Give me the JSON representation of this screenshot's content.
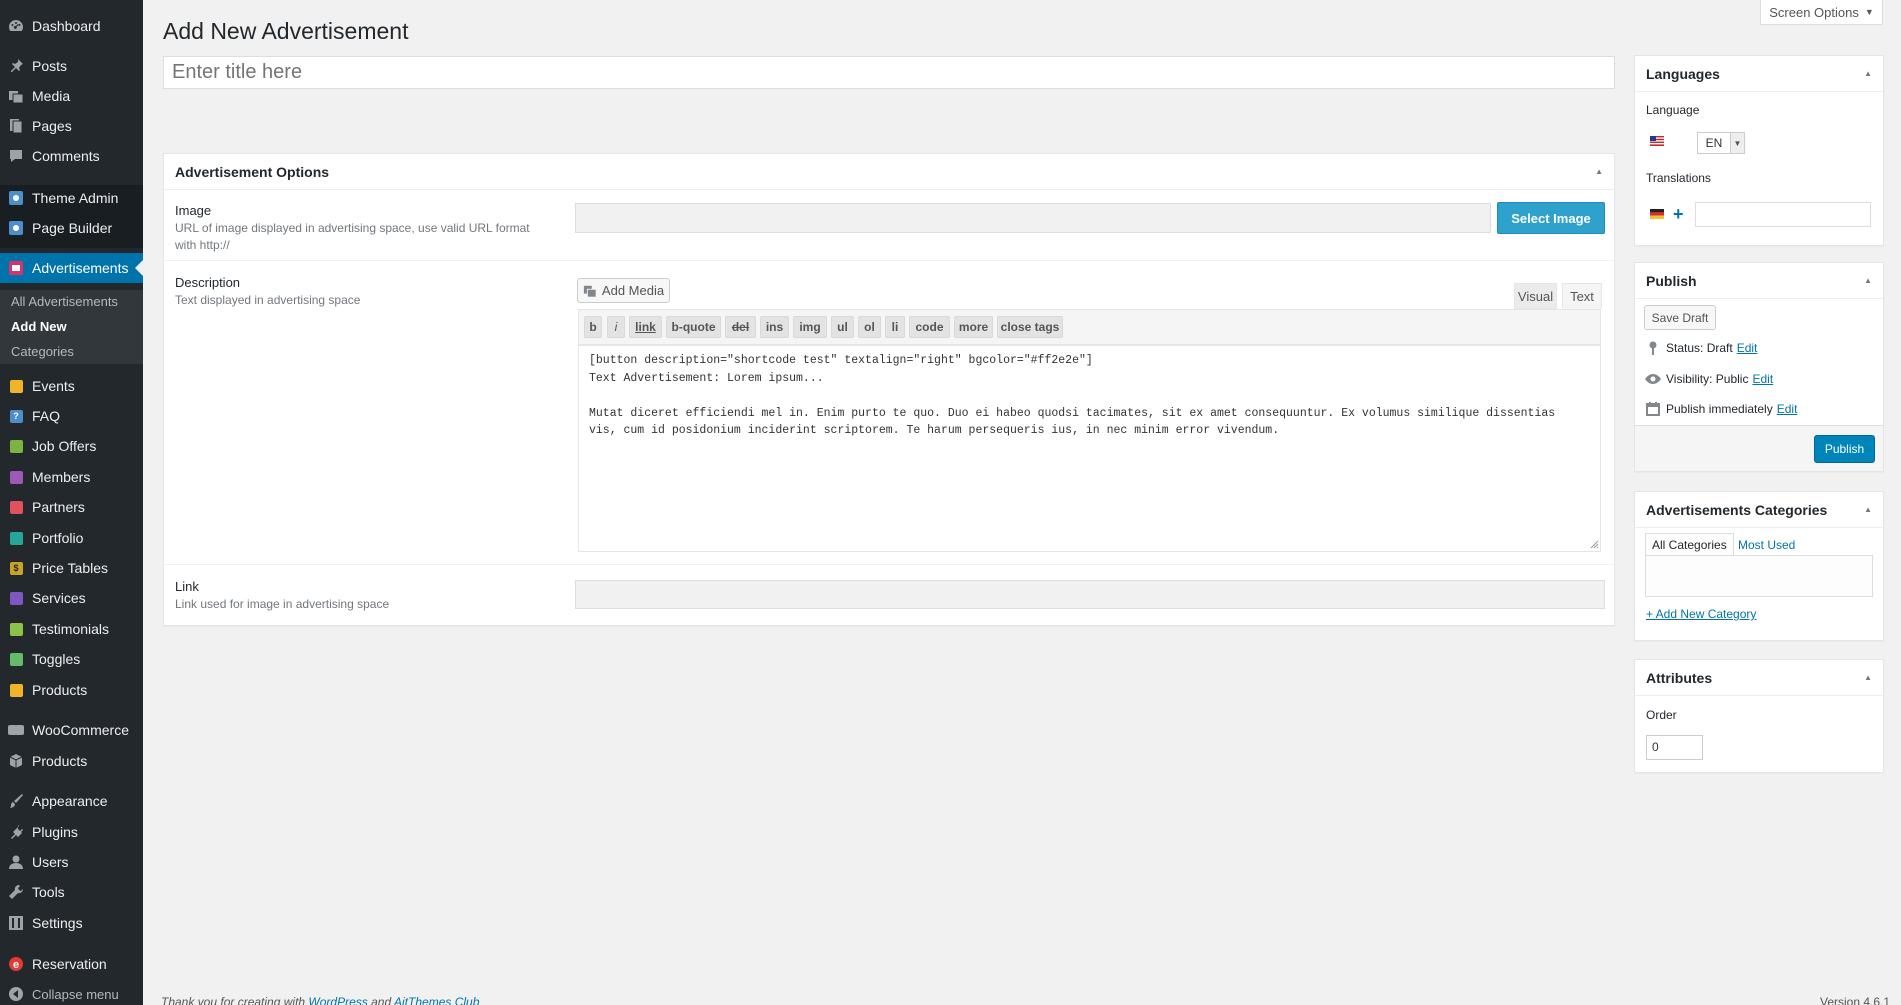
{
  "sidebar": {
    "items": [
      {
        "label": "Dashboard",
        "icon": "dashboard-icon"
      },
      {
        "label": "Posts",
        "icon": "pin-icon"
      },
      {
        "label": "Media",
        "icon": "media-icon"
      },
      {
        "label": "Pages",
        "icon": "pages-icon"
      },
      {
        "label": "Comments",
        "icon": "comment-icon"
      },
      {
        "label": "Theme Admin",
        "icon": "theme-admin-icon"
      },
      {
        "label": "Page Builder",
        "icon": "page-builder-icon"
      },
      {
        "label": "Advertisements",
        "icon": "advertisement-icon"
      },
      {
        "label": "Events",
        "icon": "events-icon"
      },
      {
        "label": "FAQ",
        "icon": "faq-icon"
      },
      {
        "label": "Job Offers",
        "icon": "job-offers-icon"
      },
      {
        "label": "Members",
        "icon": "members-icon"
      },
      {
        "label": "Partners",
        "icon": "partners-icon"
      },
      {
        "label": "Portfolio",
        "icon": "portfolio-icon"
      },
      {
        "label": "Price Tables",
        "icon": "price-tables-icon"
      },
      {
        "label": "Services",
        "icon": "services-icon"
      },
      {
        "label": "Testimonials",
        "icon": "testimonials-icon"
      },
      {
        "label": "Toggles",
        "icon": "toggles-icon"
      },
      {
        "label": "Products",
        "icon": "products-icon"
      },
      {
        "label": "WooCommerce",
        "icon": "woocommerce-icon"
      },
      {
        "label": "Products",
        "icon": "box-icon"
      },
      {
        "label": "Appearance",
        "icon": "brush-icon"
      },
      {
        "label": "Plugins",
        "icon": "plugin-icon"
      },
      {
        "label": "Users",
        "icon": "user-icon"
      },
      {
        "label": "Tools",
        "icon": "wrench-icon"
      },
      {
        "label": "Settings",
        "icon": "settings-icon"
      },
      {
        "label": "Reservation",
        "icon": "reservation-icon"
      },
      {
        "label": "Collapse menu",
        "icon": "collapse-icon"
      }
    ],
    "submenu": {
      "all": "All Advertisements",
      "add_new": "Add New",
      "categories": "Categories"
    },
    "badge_letters": {
      "faq": "?",
      "price": "$"
    }
  },
  "header": {
    "title": "Add New Advertisement",
    "screen_options": "Screen Options",
    "screen_options_arrow": "▼"
  },
  "title_input": {
    "placeholder": "Enter title here"
  },
  "adv_options": {
    "heading": "Advertisement Options",
    "image_label": "Image",
    "image_desc": "URL of image displayed in advertising space, use valid URL format with http://",
    "select_image": "Select Image",
    "description_label": "Description",
    "description_desc": "Text displayed in advertising space",
    "link_label": "Link",
    "link_desc": "Link used for image in advertising space"
  },
  "editor": {
    "add_media": "Add Media",
    "tab_visual": "Visual",
    "tab_text": "Text",
    "quicktags": [
      "b",
      "i",
      "link",
      "b-quote",
      "del",
      "ins",
      "img",
      "ul",
      "ol",
      "li",
      "code",
      "more",
      "close tags"
    ],
    "content": "[button description=\"shortcode test\" textalign=\"right\" bgcolor=\"#ff2e2e\"]\nText Advertisement: Lorem ipsum...\n\nMutat diceret efficiendi mel in. Enim purto te quo. Duo ei habeo quodsi tacimates, sit ex amet consequuntur. Ex volumus similique dissentias\nvis, cum id posidonium inciderint scriptorem. Te harum persequeris ius, in nec minim error vivendum."
  },
  "languages": {
    "heading": "Languages",
    "language_label": "Language",
    "selected": "EN",
    "translations_label": "Translations"
  },
  "publish": {
    "heading": "Publish",
    "save_draft": "Save Draft",
    "status_label": "Status: Draft",
    "visibility_label": "Visibility: Public",
    "schedule_label": "Publish immediately",
    "edit": "Edit",
    "publish_button": "Publish"
  },
  "categories": {
    "heading": "Advertisements Categories",
    "tab_all": "All Categories",
    "tab_most_used": "Most Used",
    "add_new": "+ Add New Category"
  },
  "attributes": {
    "heading": "Attributes",
    "order_label": "Order",
    "order_value": "0"
  },
  "footer": {
    "thanks": "Thank you for creating with",
    "wordpress": "WordPress",
    "and": "and",
    "ait": "AitThemes Club",
    "version": "Version 4.6.1"
  },
  "colors": {
    "sidebar_bg": "#23282d",
    "active_menu": "#0073aa",
    "primary_button": "#0085ba",
    "select_image_button": "#2ea2cc",
    "link": "#0073aa"
  }
}
